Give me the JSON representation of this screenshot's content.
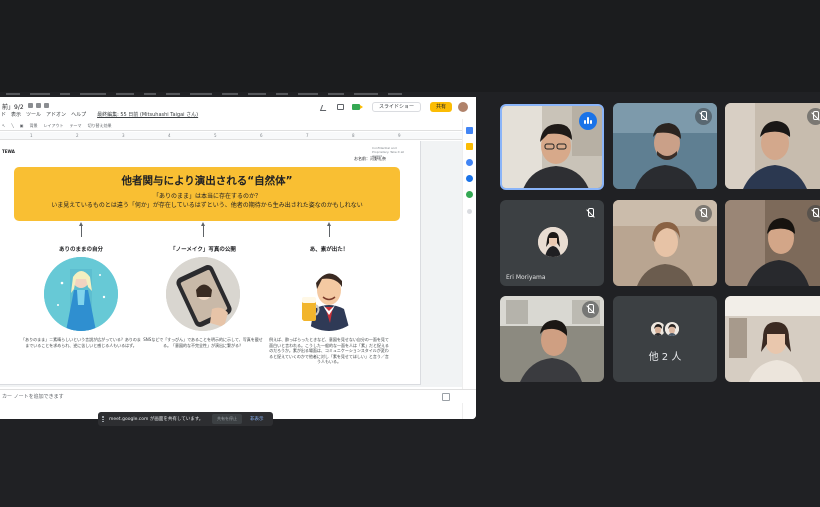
{
  "slides_window": {
    "doc_title": "前」9/2",
    "menu_items": [
      "ド",
      "表示",
      "ツール",
      "アドオン",
      "ヘルプ"
    ],
    "last_edit_note": "最終編集: 55 日前 (Mitsuhashi Taigai さん)",
    "slideshow_label": "スライドショー",
    "share_label": "共有",
    "toolbar_items": [
      "背景",
      "レイアウト",
      "テーマ",
      "切り替え効果"
    ],
    "ruler_numbers": [
      "1",
      "2",
      "3",
      "4",
      "5",
      "6",
      "7",
      "8",
      "9"
    ],
    "speaker_notes_placeholder": "カー ノートを追加できます"
  },
  "slide": {
    "logo": "TEWA",
    "confidential": "Confidential and Proprietary. Take it all 4/2021",
    "author": "お名前：河野礼奈",
    "banner_title": "他者関与により演出される“自然体”",
    "banner_sub1": "「ありのまま」は本当に存在するのか？",
    "banner_sub2": "いま見えているものとは違う「何か」が存在しているはずという、他者の期待から生み出された姿なのかもしれない",
    "columns": [
      {
        "heading": "ありのままの自分",
        "text": "「ありのまま」＝素晴らしいという言説が広がっている？ありのままでいることを求められ、逆に苦しいと感じる人もいるはず。"
      },
      {
        "heading": "「ノーメイク」写真の公開",
        "text": "SNSなどで「すっぴん」であることを明示的に示して、写真を載せる。「意図的な不完全性」が演出に繋がる？"
      },
      {
        "heading": "あ、素が出た！",
        "text": "例えば、酔っぱらったときなど、意図を見せない自分の一面を見て面白いと言われる。こうした一般的な一面を人は「素」だと捉えるのだろうか。素が出る場面は、コミュニケーションスタイルが変わると捉えていくのかで他者に対し「素を見せてほしい」と言う／言う人もいる。"
      }
    ]
  },
  "share_toast": {
    "text": "meet.google.com が画面を共有しています。",
    "stop_label": "共有を停止",
    "hide_label": "非表示"
  },
  "participants": [
    {
      "name": "",
      "speaking": true,
      "muted": false
    },
    {
      "name": "",
      "muted": true
    },
    {
      "name": "",
      "muted": true
    },
    {
      "name": "Eri Moriyama",
      "muted": true,
      "avatar_only": true
    },
    {
      "name": "",
      "muted": true
    },
    {
      "name": "",
      "muted": true
    },
    {
      "name": "",
      "muted": true
    },
    {
      "name": "他 2 人",
      "others": true
    },
    {
      "name": "",
      "muted": false
    }
  ],
  "colors": {
    "banner": "#f9bf33",
    "meet_bg": "#202124",
    "active_speaker": "#8ab4f8",
    "share_button": "#fbbc04"
  }
}
